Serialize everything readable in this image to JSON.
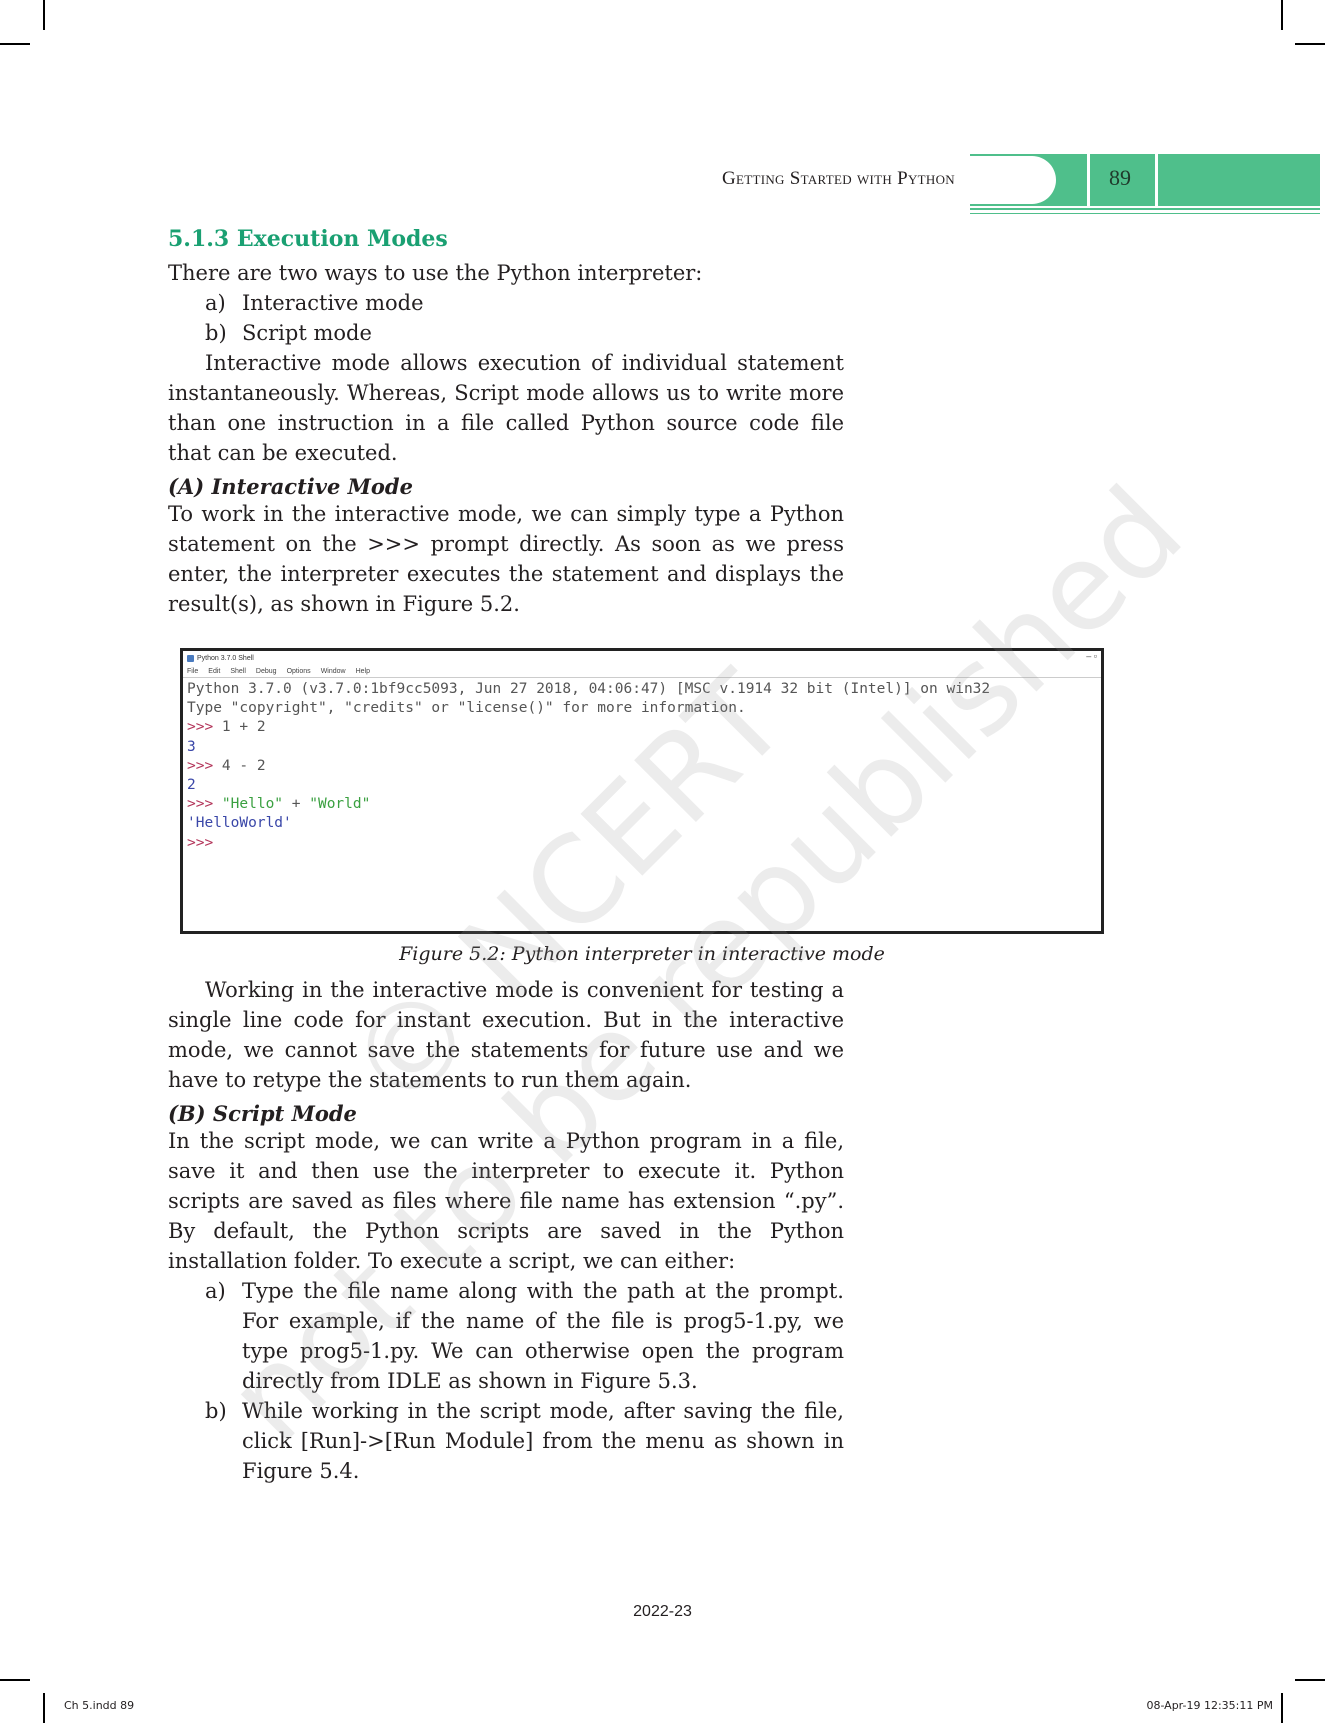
{
  "header": {
    "running_title": "Getting Started with Python",
    "page_number": "89",
    "accent_color": "#4fbf8b"
  },
  "section": {
    "heading": "5.1.3 Execution Modes",
    "intro": "There are two ways to use the Python interpreter:",
    "modes": [
      {
        "mark": "a)",
        "text": "Interactive mode"
      },
      {
        "mark": "b)",
        "text": "Script mode"
      }
    ],
    "summary": "Interactive mode allows execution of individual statement instantaneously. Whereas, Script mode allows us to write more than one instruction in a file called Python source code file that can be executed."
  },
  "interactive": {
    "heading": "(A)  Interactive Mode",
    "para1": "To work in the interactive mode, we can simply type a Python statement on the >>> prompt directly. As soon as we press enter, the interpreter executes the statement and displays the result(s), as shown in Figure 5.2.",
    "para2": "Working in the interactive mode is convenient for testing a single line code for instant execution. But in the interactive mode, we cannot save the statements for future use and we have to retype the statements to run them again."
  },
  "figure": {
    "window_title": "Python 3.7.0 Shell",
    "window_controls": "–  ▫",
    "menu": [
      "File",
      "Edit",
      "Shell",
      "Debug",
      "Options",
      "Window",
      "Help"
    ],
    "banner_line1": "Python 3.7.0 (v3.7.0:1bf9cc5093, Jun 27 2018, 04:06:47) [MSC v.1914 32 bit (Intel)] on win32",
    "banner_line2": "Type \"copyright\", \"credits\" or \"license()\" for more information.",
    "prompt": ">>> ",
    "session": [
      {
        "input": "1 + 2",
        "output": "3"
      },
      {
        "input": "4 - 2",
        "output": "2"
      },
      {
        "input_str1": "\"Hello\"",
        "input_op": " + ",
        "input_str2": "\"World\"",
        "output": "'HelloWorld'"
      }
    ],
    "final_prompt": ">>>",
    "caption": "Figure 5.2:  Python interpreter in interactive mode"
  },
  "script": {
    "heading": "(B)  Script Mode",
    "para": "In the script mode, we can write a Python program in a file, save it and then use the interpreter to execute it. Python scripts are saved as files where file name has extension “.py”. By default, the Python scripts are saved in the Python installation folder. To execute a script, we can either:",
    "steps": [
      {
        "mark": "a)",
        "text": "Type the file name along with the path at the prompt. For example, if the name of the file is prog5-1.py, we type prog5-1.py. We can otherwise open the program directly from IDLE as shown in Figure 5.3."
      },
      {
        "mark": "b)",
        "text": "While working in the script mode, after saving the file, click [Run]->[Run Module] from the menu as shown in Figure 5.4."
      }
    ]
  },
  "watermark": {
    "line1": "© NCERT",
    "line2": "not to be republished"
  },
  "footer": {
    "year": "2022-23",
    "slug_left": "Ch 5.indd   89",
    "slug_right": "08-Apr-19   12:35:11 PM"
  }
}
